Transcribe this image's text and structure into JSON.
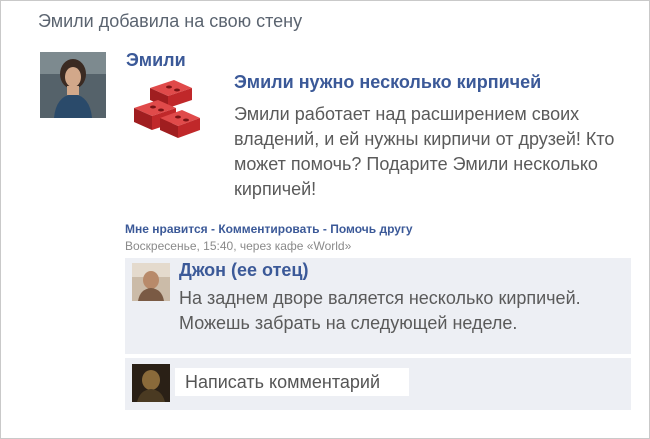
{
  "feed": {
    "header": "Эмили добавила на свою стену"
  },
  "post": {
    "author": "Эмили",
    "attachment": {
      "title": "Эмили нужно несколько кирпичей",
      "description": "Эмили работает над расширением своих владений, и ей нужны кирпичи от друзей! Кто может помочь? Подарите Эмили несколько кирпичей!",
      "icon": "bricks-icon"
    },
    "actions": {
      "like": "Мне нравится",
      "comment": "Комментировать",
      "help": "Помочь другу",
      "separator": " - "
    },
    "timestamp": "Воскресенье, 15:40, через кафе «World»"
  },
  "comment": {
    "author": "Джон (ее отец)",
    "text": "На заднем дворе валяется несколько кирпичей. Можешь забрать на следующей неделе."
  },
  "reply": {
    "placeholder": "Написать комментарий"
  },
  "colors": {
    "link": "#3b5998",
    "text": "#5a5a5a",
    "muted": "#8a8a8a",
    "comment_bg": "#edeff4",
    "brick": "#c0282a"
  }
}
